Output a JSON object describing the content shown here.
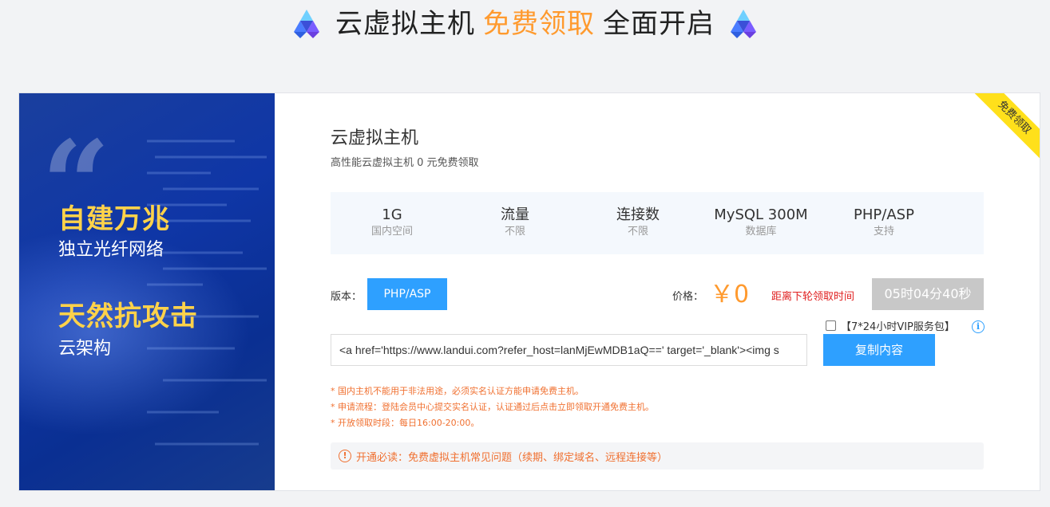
{
  "header": {
    "title_part1": "云虚拟主机",
    "title_highlight": "免费领取",
    "title_part2": "全面开启",
    "logo_icon": "pyramid-logo-icon"
  },
  "banner": {
    "headline1": "自建万兆",
    "subline1": "独立光纤网络",
    "headline2": "天然抗攻击",
    "subline2": "云架构"
  },
  "ribbon": {
    "label": "免费领取"
  },
  "product": {
    "title": "云虚拟主机",
    "description": "高性能云虚拟主机 0 元免费领取"
  },
  "specs": [
    {
      "value": "1G",
      "label": "国内空间"
    },
    {
      "value": "流量",
      "label": "不限"
    },
    {
      "value": "连接数",
      "label": "不限"
    },
    {
      "value": "MySQL 300M",
      "label": "数据库"
    },
    {
      "value": "PHP/ASP",
      "label": "支持"
    }
  ],
  "version": {
    "label": "版本：",
    "selected": "PHP/ASP"
  },
  "price": {
    "label": "价格：",
    "value": "￥0"
  },
  "countdown": {
    "label": "距离下轮领取时间",
    "value": "05时04分40秒"
  },
  "vip": {
    "label": "【7*24小时VIP服务包】",
    "checked": false,
    "info_icon": "info-icon"
  },
  "code": {
    "value": "<a href='https://www.landui.com?refer_host=lanMjEwMDB1aQ==' target='_blank'><img s"
  },
  "copy_button": {
    "label": "复制内容"
  },
  "notes": [
    "* 国内主机不能用于非法用途，必须实名认证方能申请免费主机。",
    "* 申请流程：登陆会员中心提交实名认证，认证通过后点击立即领取开通免费主机。",
    "* 开放领取时段：每日16:00-20:00。"
  ],
  "notice": {
    "label": "开通必读：免费虚拟主机常见问题（续期、绑定域名、远程连接等）",
    "icon": "warning-icon"
  },
  "colors": {
    "accent_blue": "#2ea0ff",
    "highlight_orange": "#ff9a2e",
    "banner_yellow": "#ffd24a",
    "ribbon_yellow": "#ffe01b",
    "countdown_red": "#e02020",
    "note_orange": "#f07030"
  }
}
